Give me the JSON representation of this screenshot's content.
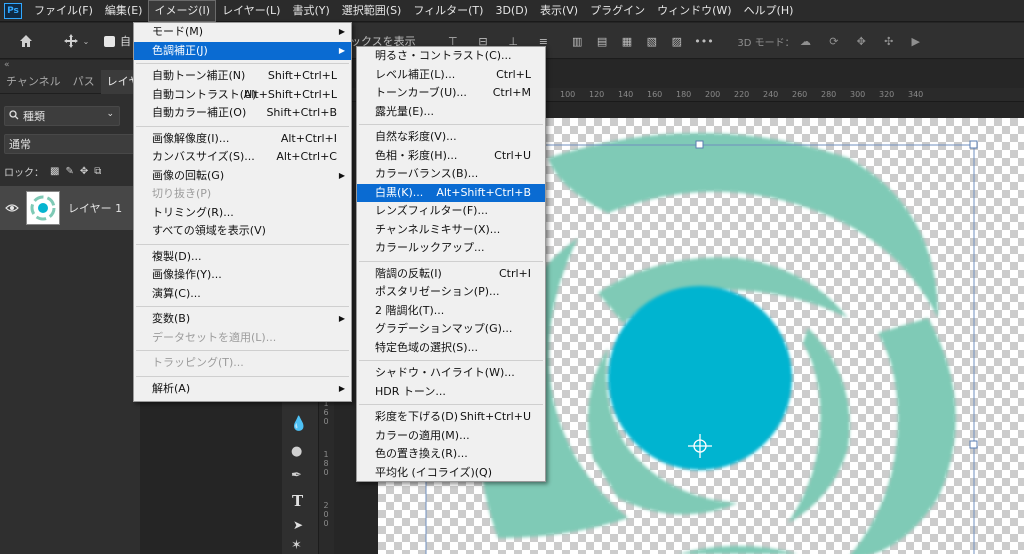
{
  "menubar": {
    "logo": "Ps",
    "items": [
      "ファイル(F)",
      "編集(E)",
      "イメージ(I)",
      "レイヤー(L)",
      "書式(Y)",
      "選択範囲(S)",
      "フィルター(T)",
      "3D(D)",
      "表示(V)",
      "プラグイン",
      "ウィンドウ(W)",
      "ヘルプ(H)"
    ]
  },
  "options": {
    "bounding_label_partial": "ックスを表示",
    "auto_label_partial": "自",
    "mode_3d": "3D モード："
  },
  "panel": {
    "collapse": "«",
    "tabs": [
      "チャンネル",
      "パス",
      "レイヤー"
    ],
    "filter": "種類",
    "blend_mode": "通常",
    "lock_label": "ロック：",
    "layer_name": "レイヤー 1"
  },
  "ruler": {
    "top": [
      "100",
      "120",
      "140",
      "160",
      "180",
      "200",
      "220",
      "240",
      "260",
      "280",
      "300",
      "320",
      "340"
    ],
    "left": [
      "1",
      "6",
      "0",
      "1",
      "8",
      "0",
      "2",
      "0",
      "0"
    ]
  },
  "image_menu": {
    "items": [
      {
        "label": "モード(M)",
        "shortcut": "",
        "submenu": true
      },
      {
        "label": "色調補正(J)",
        "shortcut": "",
        "submenu": true,
        "highlighted": true
      },
      {
        "sep": true
      },
      {
        "label": "自動トーン補正(N)",
        "shortcut": "Shift+Ctrl+L"
      },
      {
        "label": "自動コントラスト(U)",
        "shortcut": "Alt+Shift+Ctrl+L"
      },
      {
        "label": "自動カラー補正(O)",
        "shortcut": "Shift+Ctrl+B"
      },
      {
        "sep": true
      },
      {
        "label": "画像解像度(I)...",
        "shortcut": "Alt+Ctrl+I"
      },
      {
        "label": "カンバスサイズ(S)...",
        "shortcut": "Alt+Ctrl+C"
      },
      {
        "label": "画像の回転(G)",
        "shortcut": "",
        "submenu": true
      },
      {
        "label": "切り抜き(P)",
        "shortcut": "",
        "disabled": true
      },
      {
        "label": "トリミング(R)...",
        "shortcut": ""
      },
      {
        "label": "すべての領域を表示(V)",
        "shortcut": ""
      },
      {
        "sep": true
      },
      {
        "label": "複製(D)...",
        "shortcut": ""
      },
      {
        "label": "画像操作(Y)...",
        "shortcut": ""
      },
      {
        "label": "演算(C)...",
        "shortcut": ""
      },
      {
        "sep": true
      },
      {
        "label": "変数(B)",
        "shortcut": "",
        "submenu": true
      },
      {
        "label": "データセットを適用(L)...",
        "shortcut": "",
        "disabled": true
      },
      {
        "sep": true
      },
      {
        "label": "トラッピング(T)...",
        "shortcut": "",
        "disabled": true
      },
      {
        "sep": true
      },
      {
        "label": "解析(A)",
        "shortcut": "",
        "submenu": true
      }
    ]
  },
  "adjust_menu": {
    "items": [
      {
        "label": "明るさ・コントラスト(C)...",
        "shortcut": ""
      },
      {
        "label": "レベル補正(L)...",
        "shortcut": "Ctrl+L"
      },
      {
        "label": "トーンカーブ(U)...",
        "shortcut": "Ctrl+M"
      },
      {
        "label": "露光量(E)...",
        "shortcut": ""
      },
      {
        "sep": true
      },
      {
        "label": "自然な彩度(V)...",
        "shortcut": ""
      },
      {
        "label": "色相・彩度(H)...",
        "shortcut": "Ctrl+U"
      },
      {
        "label": "カラーバランス(B)...",
        "shortcut": ""
      },
      {
        "label": "白黒(K)...",
        "shortcut": "Alt+Shift+Ctrl+B",
        "highlighted": true
      },
      {
        "label": "レンズフィルター(F)...",
        "shortcut": ""
      },
      {
        "label": "チャンネルミキサー(X)...",
        "shortcut": ""
      },
      {
        "label": "カラールックアップ...",
        "shortcut": ""
      },
      {
        "sep": true
      },
      {
        "label": "階調の反転(I)",
        "shortcut": "Ctrl+I"
      },
      {
        "label": "ポスタリゼーション(P)...",
        "shortcut": ""
      },
      {
        "label": "2 階調化(T)...",
        "shortcut": ""
      },
      {
        "label": "グラデーションマップ(G)...",
        "shortcut": ""
      },
      {
        "label": "特定色域の選択(S)...",
        "shortcut": ""
      },
      {
        "sep": true
      },
      {
        "label": "シャドウ・ハイライト(W)...",
        "shortcut": ""
      },
      {
        "label": "HDR トーン...",
        "shortcut": ""
      },
      {
        "sep": true
      },
      {
        "label": "彩度を下げる(D)",
        "shortcut": "Shift+Ctrl+U"
      },
      {
        "label": "カラーの適用(M)...",
        "shortcut": ""
      },
      {
        "label": "色の置き換え(R)...",
        "shortcut": ""
      },
      {
        "label": "平均化 (イコライズ)(Q)",
        "shortcut": ""
      }
    ]
  },
  "colors": {
    "swirl": "#7fcab6",
    "core": "#06b4d0",
    "menu_highlight": "#0a6bd2"
  }
}
